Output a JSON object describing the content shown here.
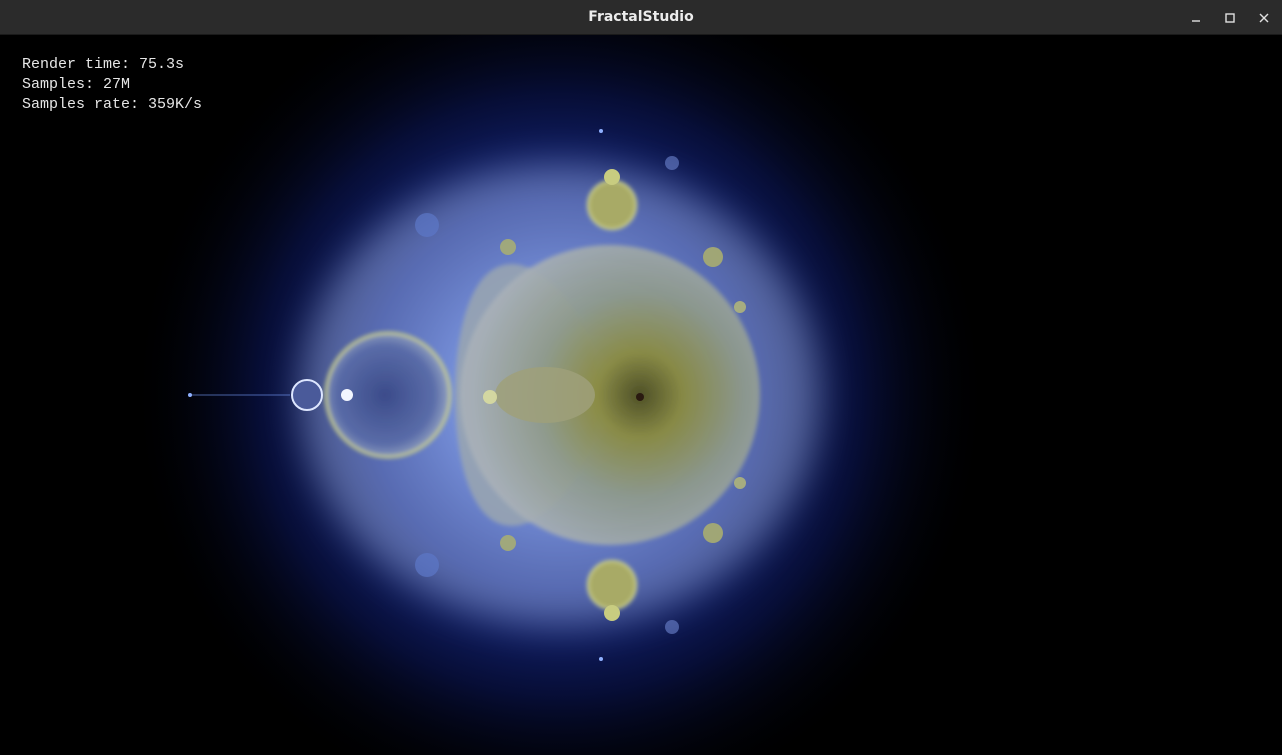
{
  "window": {
    "title": "FractalStudio",
    "controls": {
      "minimize_icon": "minimize-icon",
      "maximize_icon": "maximize-icon",
      "close_icon": "close-icon"
    }
  },
  "overlay": {
    "render_time": "Render time: 75.3s",
    "samples": "Samples: 27M",
    "samples_rate": "Samples rate: 359K/s"
  },
  "colors": {
    "titlebar": "#2b2b2b",
    "title_text": "#ececec",
    "background": "#000000",
    "glow_blue": "#1f3fbf",
    "glow_light": "#a9c4ff",
    "fractal_yellow": "#c8c860",
    "fractal_core": "#6b6a2a"
  }
}
